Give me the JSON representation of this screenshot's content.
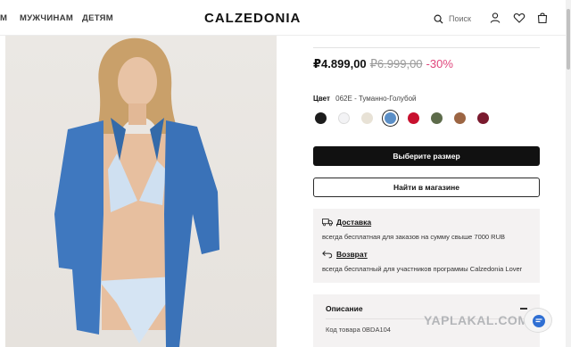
{
  "header": {
    "nav": [
      {
        "label": "М"
      },
      {
        "label": "МУЖЧИНАМ"
      },
      {
        "label": "ДЕТЯМ"
      }
    ],
    "logo": "CALZEDONIA",
    "search_label": "Поиск",
    "icons": [
      "search-icon",
      "user-icon",
      "heart-icon",
      "bag-icon"
    ]
  },
  "product": {
    "price": "₽4.899,00",
    "old_price": "₽6.999,00",
    "discount": "-30%",
    "color_label": "Цвет",
    "color_value": "062E - Туманно-Голубой",
    "swatches": [
      {
        "color": "#1c1c1c"
      },
      {
        "color": "#f3f3f5"
      },
      {
        "color": "#e8e2d6"
      },
      {
        "color": "#5b8fc7",
        "selected": true
      },
      {
        "color": "#c8102e"
      },
      {
        "color": "#5d6b4a"
      },
      {
        "color": "#9c6543"
      },
      {
        "color": "#7a1a2e"
      }
    ],
    "choose_size": "Выберите размер",
    "find_in_store": "Найти в магазине"
  },
  "info": {
    "delivery_title": "Доставка",
    "delivery_text": "всегда бесплатная для заказов на сумму свыше 7000 RUB",
    "return_title": "Возврат",
    "return_text": "всегда бесплатный для участников программы Calzedonia Lover"
  },
  "description": {
    "title": "Описание",
    "sku": "Код товара 0BDA104"
  },
  "watermark": "YAPLAKAL.COM"
}
